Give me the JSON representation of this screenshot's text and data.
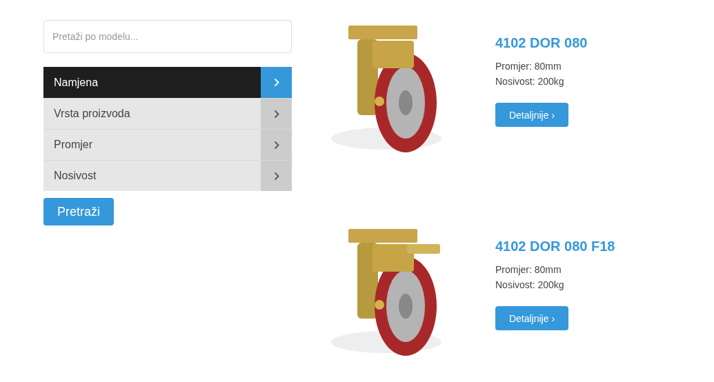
{
  "search": {
    "placeholder": "Pretaži po modelu..."
  },
  "filters": [
    {
      "label": "Namjena",
      "selected": true
    },
    {
      "label": "Vrsta proizvoda",
      "selected": false
    },
    {
      "label": "Promjer",
      "selected": false
    },
    {
      "label": "Nosivost",
      "selected": false
    }
  ],
  "search_button": "Pretraži",
  "products": [
    {
      "title": "4102 DOR 080",
      "lines": [
        "Promjer: 80mm",
        "Nosivost: 200kg"
      ],
      "button": "Detaljnije ›",
      "brake": false
    },
    {
      "title": "4102 DOR 080 F18",
      "lines": [
        "Promjer: 80mm",
        "Nosivost: 200kg"
      ],
      "button": "Detaljnije ›",
      "brake": true
    }
  ]
}
